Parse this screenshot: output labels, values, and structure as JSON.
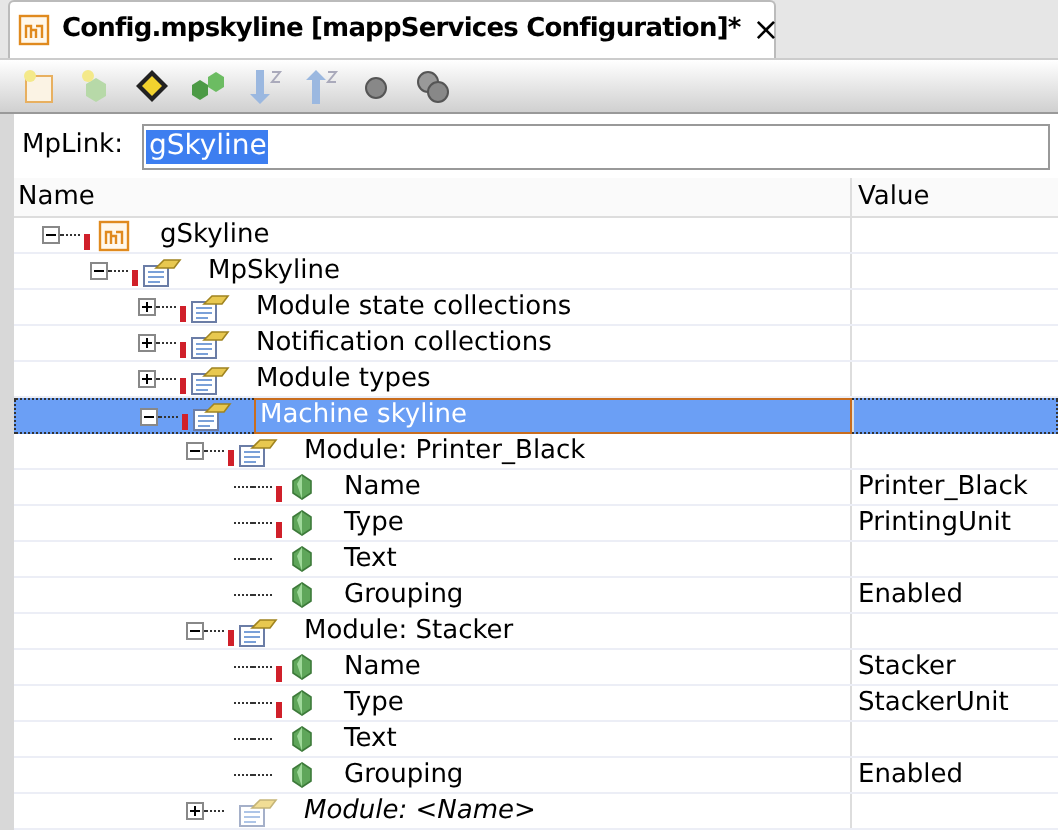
{
  "tab": {
    "title": "Config.mpskyline [mappServices Configuration]*",
    "close": "×"
  },
  "mplink": {
    "label": "MpLink:",
    "value": "gSkyline"
  },
  "columns": [
    "Name",
    "Value"
  ],
  "tree": [
    {
      "name": "gSkyline",
      "kind": "module",
      "required": true,
      "expanded": true,
      "selected": false,
      "children": [
        {
          "name": "MpSkyline",
          "kind": "folder",
          "required": true,
          "expanded": true,
          "selected": false,
          "children": [
            {
              "name": "Module state collections",
              "kind": "folder",
              "required": true,
              "expanded": false,
              "selected": false
            },
            {
              "name": "Notification collections",
              "kind": "folder",
              "required": true,
              "expanded": false,
              "selected": false
            },
            {
              "name": "Module types",
              "kind": "folder",
              "required": true,
              "expanded": false,
              "selected": false
            },
            {
              "name": "Machine skyline",
              "kind": "folder",
              "required": true,
              "expanded": true,
              "selected": true,
              "children": [
                {
                  "name": "Module: Printer_Black",
                  "kind": "folder",
                  "required": true,
                  "expanded": true,
                  "selected": false,
                  "children": [
                    {
                      "name": "Name",
                      "kind": "param",
                      "required": true,
                      "selected": false,
                      "value": "Printer_Black"
                    },
                    {
                      "name": "Type",
                      "kind": "param",
                      "required": true,
                      "selected": false,
                      "value": "PrintingUnit"
                    },
                    {
                      "name": "Text",
                      "kind": "param",
                      "required": false,
                      "selected": false
                    },
                    {
                      "name": "Grouping",
                      "kind": "param",
                      "required": false,
                      "selected": false,
                      "value": "Enabled"
                    }
                  ]
                },
                {
                  "name": "Module: Stacker",
                  "kind": "folder",
                  "required": true,
                  "expanded": true,
                  "selected": false,
                  "children": [
                    {
                      "name": "Name",
                      "kind": "param",
                      "required": true,
                      "selected": false,
                      "value": "Stacker"
                    },
                    {
                      "name": "Type",
                      "kind": "param",
                      "required": true,
                      "selected": false,
                      "value": "StackerUnit"
                    },
                    {
                      "name": "Text",
                      "kind": "param",
                      "required": false,
                      "selected": false
                    },
                    {
                      "name": "Grouping",
                      "kind": "param",
                      "required": false,
                      "selected": false,
                      "value": "Enabled"
                    }
                  ]
                },
                {
                  "name": "Module: <Name>",
                  "kind": "new",
                  "required": false,
                  "expanded": false,
                  "selected": false
                }
              ]
            }
          ]
        }
      ]
    }
  ]
}
